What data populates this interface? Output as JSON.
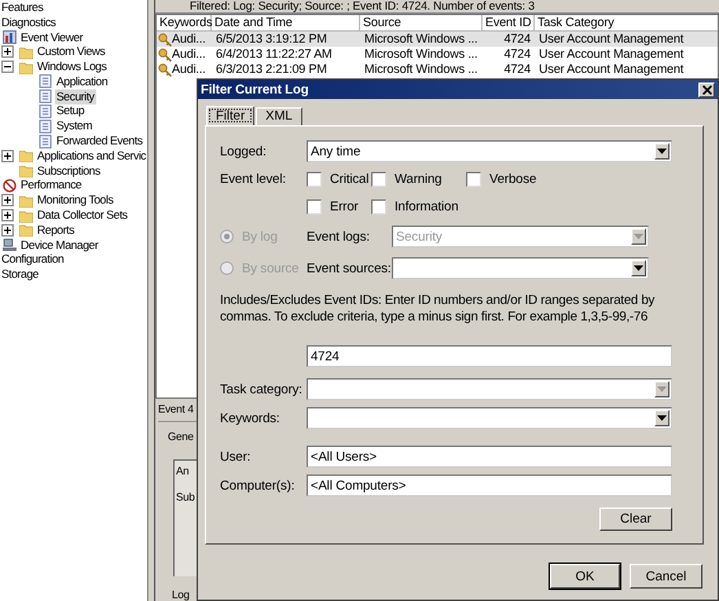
{
  "filter_bar": {
    "text": "Filtered: Log: Security; Source: ; Event ID: 4724. Number of events: 3"
  },
  "tree": [
    {
      "label": "Features"
    },
    {
      "label": "Diagnostics",
      "children": [
        {
          "label": "Event Viewer",
          "kind": "viewer",
          "children": [
            {
              "label": "Custom Views",
              "kind": "folder",
              "expanded": false
            },
            {
              "label": "Windows Logs",
              "kind": "folder",
              "expanded": true,
              "children": [
                {
                  "label": "Application",
                  "kind": "log",
                  "selected": false
                },
                {
                  "label": "Security",
                  "kind": "log",
                  "selected": true
                },
                {
                  "label": "Setup",
                  "kind": "log",
                  "selected": false
                },
                {
                  "label": "System",
                  "kind": "log",
                  "selected": false
                },
                {
                  "label": "Forwarded Events",
                  "kind": "log",
                  "selected": false
                }
              ]
            },
            {
              "label": "Applications and Servic",
              "kind": "folder",
              "expanded": false
            },
            {
              "label": "Subscriptions",
              "kind": "folder"
            }
          ]
        },
        {
          "label": "Performance",
          "kind": "gauge",
          "children": [
            {
              "label": "Monitoring Tools",
              "kind": "folder",
              "expanded": false
            },
            {
              "label": "Data Collector Sets",
              "kind": "folder",
              "expanded": false
            },
            {
              "label": "Reports",
              "kind": "folder",
              "expanded": false
            }
          ]
        },
        {
          "label": "Device Manager",
          "kind": "device"
        }
      ]
    },
    {
      "label": "Configuration"
    },
    {
      "label": "Storage"
    }
  ],
  "table": {
    "columns": [
      "Keywords",
      "Date and Time",
      "Source",
      "Event ID",
      "Task Category"
    ],
    "rows": [
      {
        "cells": [
          "Audi...",
          "6/5/2013 3:19:12 PM",
          "Microsoft Windows ...",
          "4724",
          "User Account Management"
        ],
        "selected": true
      },
      {
        "cells": [
          "Audi...",
          "6/4/2013 11:22:27 AM",
          "Microsoft Windows ...",
          "4724",
          "User Account Management"
        ],
        "selected": false
      },
      {
        "cells": [
          "Audi...",
          "6/3/2013 2:21:09 PM",
          "Microsoft Windows ...",
          "4724",
          "User Account Management"
        ],
        "selected": false
      }
    ]
  },
  "details_pane": {
    "title": "Event 4",
    "tab": "Gene",
    "lines": [
      "An",
      "Sub"
    ],
    "footer": "Log"
  },
  "dialog": {
    "title": "Filter Current Log",
    "tabs": [
      {
        "label": "Filter",
        "selected": true
      },
      {
        "label": "XML",
        "selected": false
      }
    ],
    "logged": {
      "label": "Logged:",
      "value": "Any time"
    },
    "event_level": {
      "label": "Event level:",
      "options": [
        {
          "label": "Critical",
          "checked": false
        },
        {
          "label": "Warning",
          "checked": false
        },
        {
          "label": "Verbose",
          "checked": false
        },
        {
          "label": "Error",
          "checked": false
        },
        {
          "label": "Information",
          "checked": false
        }
      ]
    },
    "scope": [
      {
        "label": "By log",
        "selected": true,
        "disabled": true,
        "field_label": "Event logs:",
        "value": "Security",
        "field_disabled": true
      },
      {
        "label": "By source",
        "selected": false,
        "disabled": true,
        "field_label": "Event sources:",
        "field_disabled": false
      }
    ],
    "event_ids": {
      "description": "Includes/Excludes Event IDs: Enter ID numbers and/or ID ranges separated by commas. To exclude criteria, type a minus sign first. For example 1,3,5-99,-76",
      "value": "4724"
    },
    "fields": [
      {
        "label": "Task category:",
        "kind": "dropdown",
        "disabled": true
      },
      {
        "label": "Keywords:",
        "kind": "dropdown",
        "disabled": false
      },
      {
        "label": "User:",
        "kind": "text",
        "value": "<All Users>"
      },
      {
        "label": "Computer(s):",
        "kind": "text",
        "value": "<All Computers>"
      }
    ],
    "clear_button": "Clear",
    "buttons": [
      "OK",
      "Cancel"
    ]
  }
}
